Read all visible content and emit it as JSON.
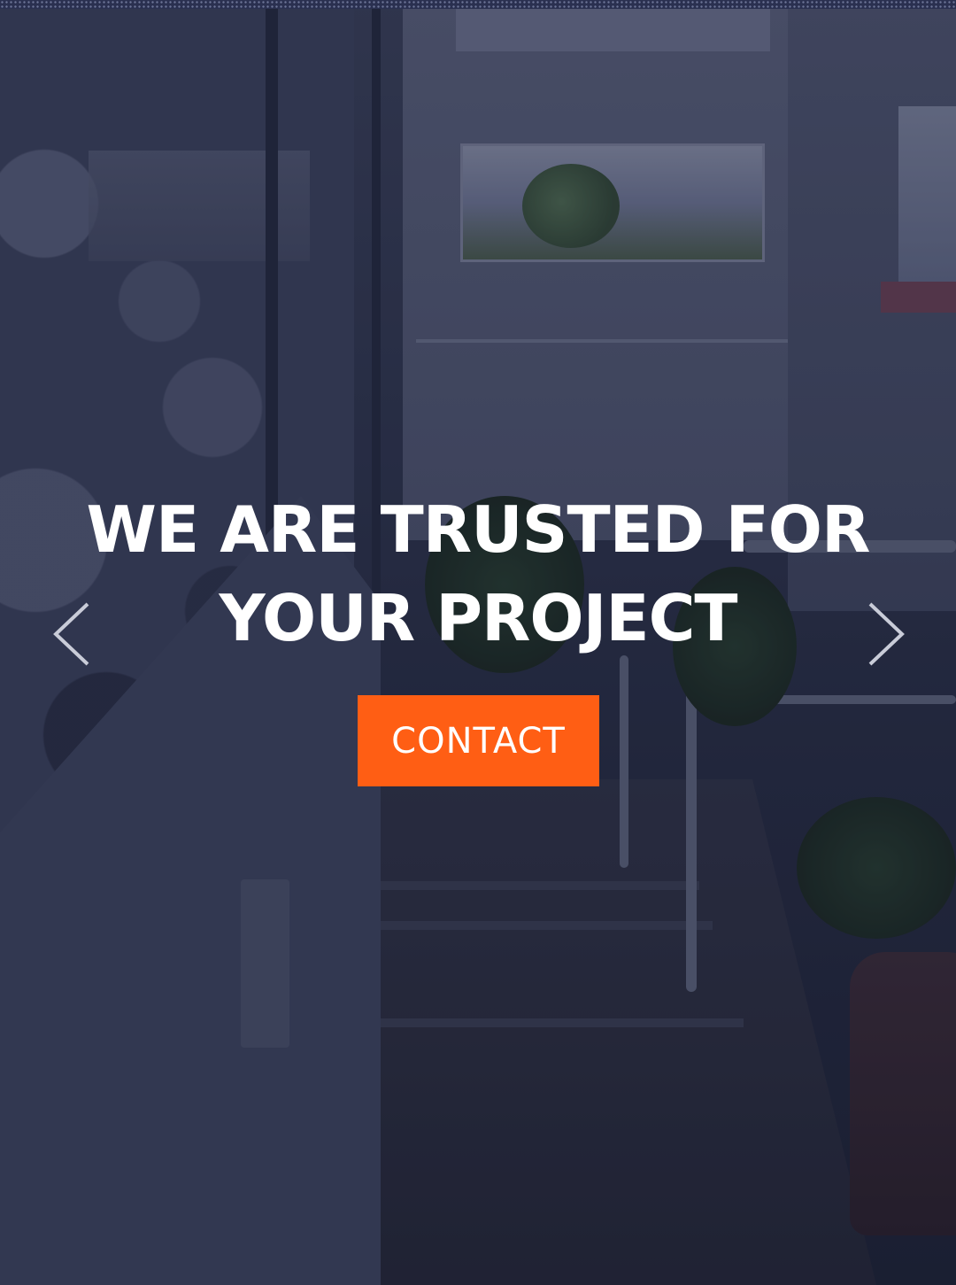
{
  "hero": {
    "headline_line1": "WE ARE TRUSTED FOR",
    "headline_line2": "YOUR PROJECT",
    "cta_label": "CONTACT",
    "prev_arrow_icon": "chevron-left-icon",
    "next_arrow_icon": "chevron-right-icon"
  },
  "colors": {
    "cta_background": "#ff5e14",
    "headline_text": "#ffffff",
    "overlay": "#161c3a",
    "arrow": "#c9ccd8"
  }
}
